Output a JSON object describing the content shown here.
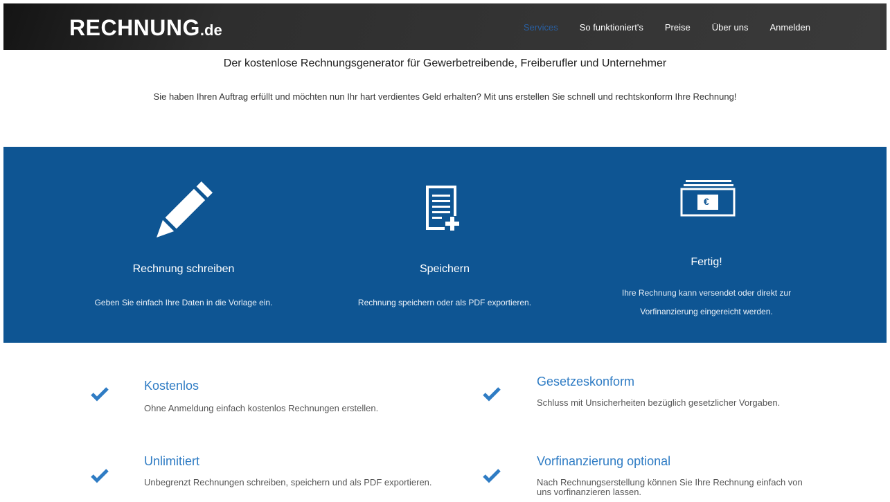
{
  "nav": {
    "logo_main": "RECHNUNG",
    "logo_tld": ".de",
    "links": [
      "Services",
      "So funktioniert's",
      "Preise",
      "Über uns",
      "Anmelden"
    ]
  },
  "intro": {
    "headline": "Der kostenlose Rechnungsgenerator für Gewerbetreibende, Freiberufler und Unternehmer",
    "subline": "Sie haben Ihren Auftrag erfüllt und möchten nun Ihr hart verdientes Geld erhalten? Mit uns erstellen Sie schnell und rechtskonform Ihre Rechnung!"
  },
  "steps": [
    {
      "icon": "pencil-icon",
      "title": "Rechnung schreiben",
      "desc": "Geben Sie einfach Ihre Daten in die Vorlage ein."
    },
    {
      "icon": "document-add-icon",
      "title": "Speichern",
      "desc": "Rechnung speichern oder als PDF exportieren."
    },
    {
      "icon": "euro-bills-icon",
      "title": "Fertig!",
      "desc_line1": "Ihre Rechnung kann versendet oder direkt zur",
      "desc_line2": "Vorfinanzierung eingereicht werden.",
      "euro_symbol": "€"
    }
  ],
  "features": [
    {
      "title": "Kostenlos",
      "desc": "Ohne Anmeldung einfach kostenlos Rechnungen erstellen."
    },
    {
      "title": "Gesetzeskonform",
      "desc": "Schluss mit Unsicherheiten bezüglich gesetzlicher Vorgaben."
    },
    {
      "title": "Unlimitiert",
      "desc": "Unbegrenzt Rechnungen schreiben, speichern und als PDF exportieren."
    },
    {
      "title": "Vorfinanzierung optional",
      "desc": "Nach Rechnungserstellung können Sie Ihre Rechnung einfach von uns vorfinanzieren lassen."
    }
  ],
  "colors": {
    "nav_bg": "#2e2e2e",
    "nav_active": "#2a5fa0",
    "band_bg": "#0e5593",
    "feature_title": "#2f7cc4",
    "check": "#2f7cc4"
  }
}
